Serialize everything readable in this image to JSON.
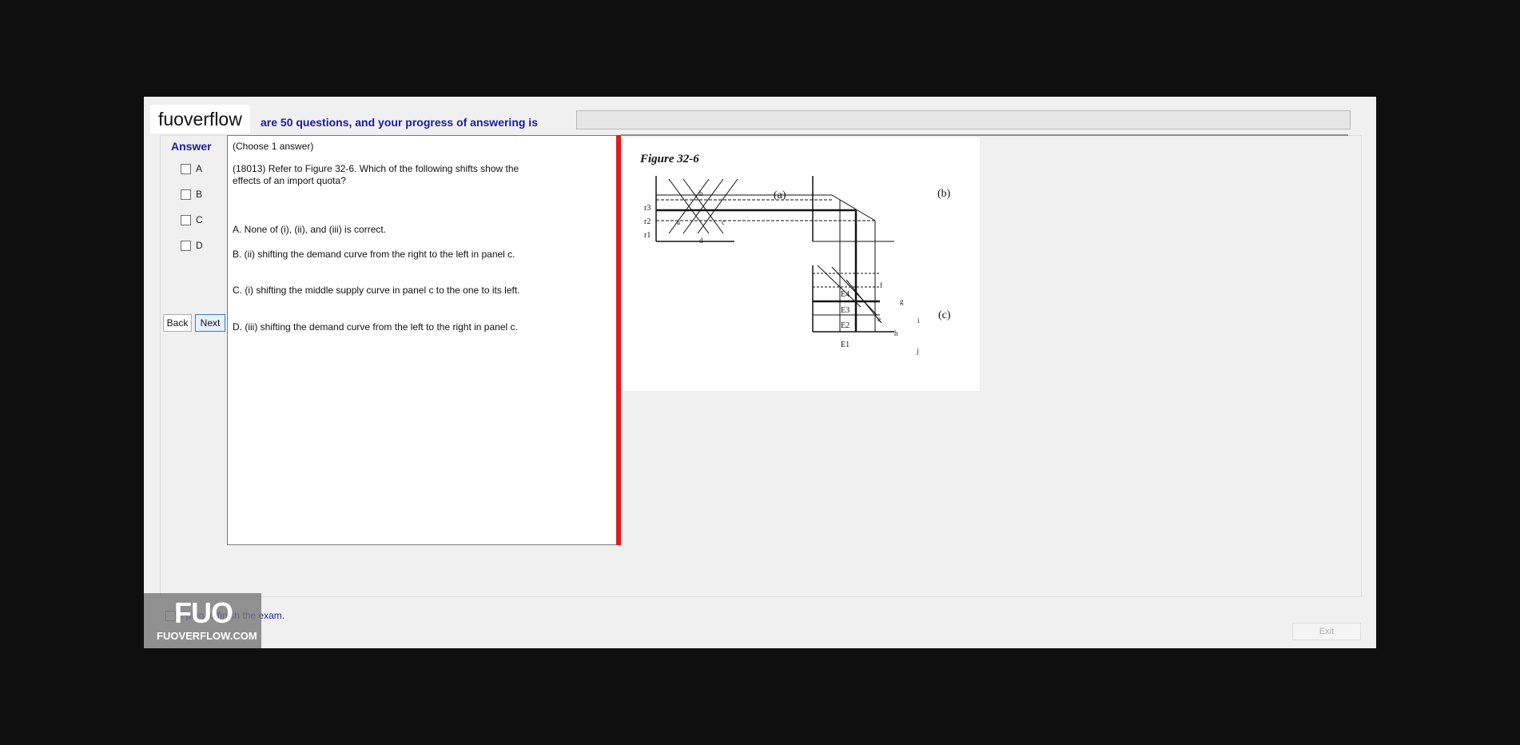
{
  "header": {
    "watermark": "fuoverflow",
    "progress_text": "are 50 questions, and your progress of answering is",
    "progress_fraction": 0
  },
  "answer": {
    "title": "Answer",
    "options": [
      "A",
      "B",
      "C",
      "D"
    ]
  },
  "nav": {
    "back": "Back",
    "next": "Next"
  },
  "question": {
    "choose": "(Choose 1 answer)",
    "text": "(18013)  Refer to Figure 32-6. Which of the following shifts show the effects of an import quota?",
    "choices": [
      "A.  None of (i), (ii), and (iii) is correct.",
      "B.  (ii) shifting the demand curve from the right to the left in panel c.",
      "C.  (i) shifting the middle supply curve in panel c to the one to its left.",
      "D.  (iii) shifting the demand curve from the left to the right in panel c."
    ]
  },
  "figure": {
    "title": "Figure 32-6",
    "panel_a": "(a)",
    "panel_b": "(b)",
    "panel_c": "(c)",
    "r_labels": [
      "r3",
      "r2",
      "r1"
    ],
    "e_labels": [
      "E4",
      "E3",
      "E2",
      "E1"
    ],
    "point_labels": [
      "a",
      "b",
      "c",
      "d",
      "e",
      "f",
      "g",
      "h",
      "i",
      "j"
    ]
  },
  "footer": {
    "finish_text": "I plan to finish the exam.",
    "exit": "Exit",
    "watermark_big": "FUO",
    "watermark_small": "FUOVERFLOW.COM"
  }
}
